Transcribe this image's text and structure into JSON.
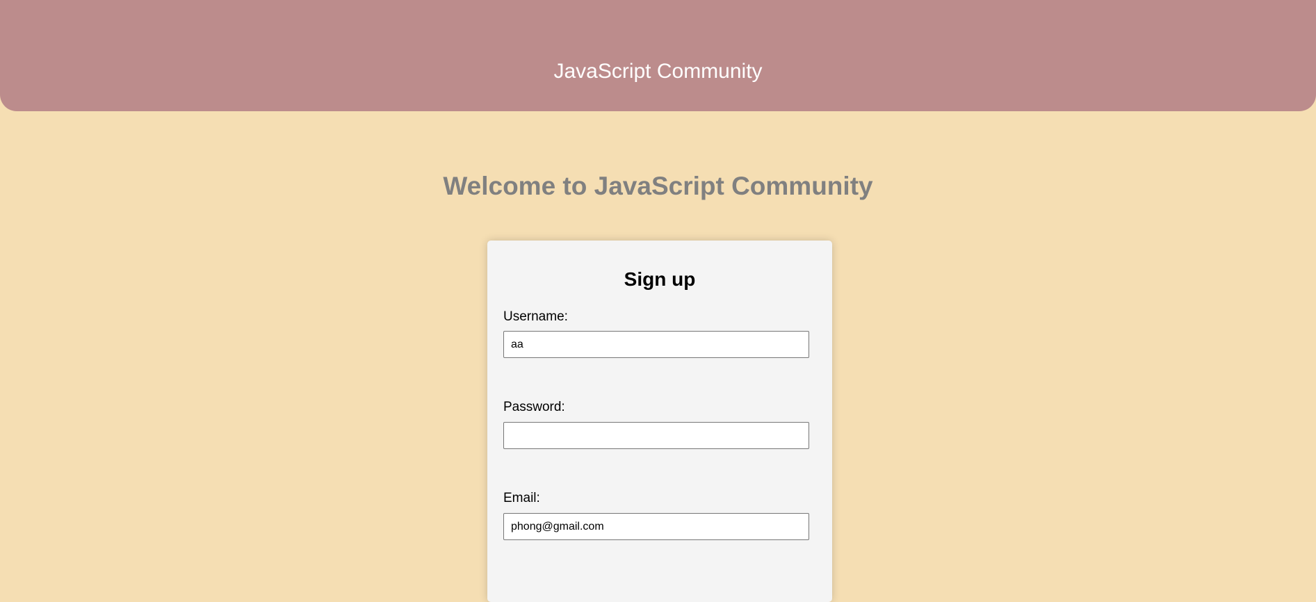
{
  "header": {
    "title": "JavaScript Community"
  },
  "welcome": {
    "heading": "Welcome to JavaScript Community"
  },
  "signup": {
    "title": "Sign up",
    "username": {
      "label": "Username:",
      "value": "aa"
    },
    "password": {
      "label": "Password:",
      "value": ""
    },
    "email": {
      "label": "Email:",
      "value": "phong@gmail.com"
    }
  },
  "colors": {
    "header_bg": "#bc8c8c",
    "page_bg": "#f5deb3",
    "card_bg": "#f4f4f4",
    "welcome_text": "#808080"
  }
}
